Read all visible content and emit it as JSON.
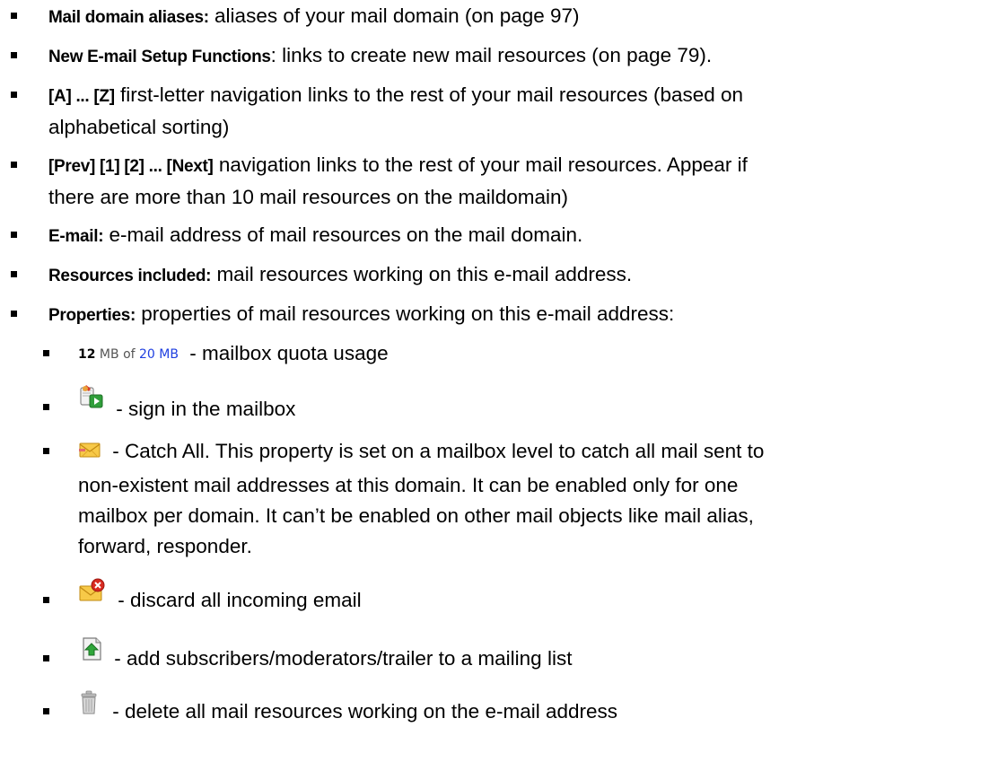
{
  "items": [
    {
      "term": "Mail domain aliases:",
      "text": " aliases of your mail domain (on page 97)"
    },
    {
      "term": "New E-mail Setup Functions",
      "text": ": links to create new mail resources (on page 79)."
    },
    {
      "term": "[A] ... [Z]",
      "line1": " first-letter navigation links to the rest of your mail resources (based on",
      "line2": "alphabetical sorting)"
    },
    {
      "term": "[Prev] [1] [2] ... [Next]",
      "line1": " navigation links to the rest of your mail resources. Appear if",
      "line2": "there are more than 10 mail resources on the maildomain)"
    },
    {
      "term": "E-mail:",
      "text": " e-mail address of mail resources on the mail domain."
    },
    {
      "term": "Resources included:",
      "text": " mail resources working on this e-mail address."
    },
    {
      "term": "Properties:",
      "text": " properties of mail resources working on this e-mail address:"
    }
  ],
  "properties": {
    "quota": {
      "used": "12",
      "of": " MB of ",
      "total": "20 MB",
      "desc": " - mailbox quota usage"
    },
    "sign_in": {
      "icon": "sign-in-mailbox-icon",
      "desc": " - sign in the mailbox"
    },
    "catch_all": {
      "icon": "catch-all-envelope-icon",
      "line1": " - Catch All. This property is set on a mailbox level to catch all mail sent to",
      "line2": "non-existent mail addresses at this domain. It can be enabled only for one",
      "line3": "mailbox per domain. It can’t be enabled on other mail objects like mail alias,",
      "line4": "forward, responder."
    },
    "discard": {
      "icon": "discard-mail-icon",
      "desc": " - discard all incoming email"
    },
    "add_subscribers": {
      "icon": "add-subscribers-icon",
      "desc": " - add subscribers/moderators/trailer to a mailing list"
    },
    "delete_all": {
      "icon": "trash-icon",
      "desc": " - delete all mail resources working on the e-mail address"
    }
  },
  "colors": {
    "text": "#000000",
    "quota_total": "#1f3fe0",
    "quota_of": "#555555"
  }
}
